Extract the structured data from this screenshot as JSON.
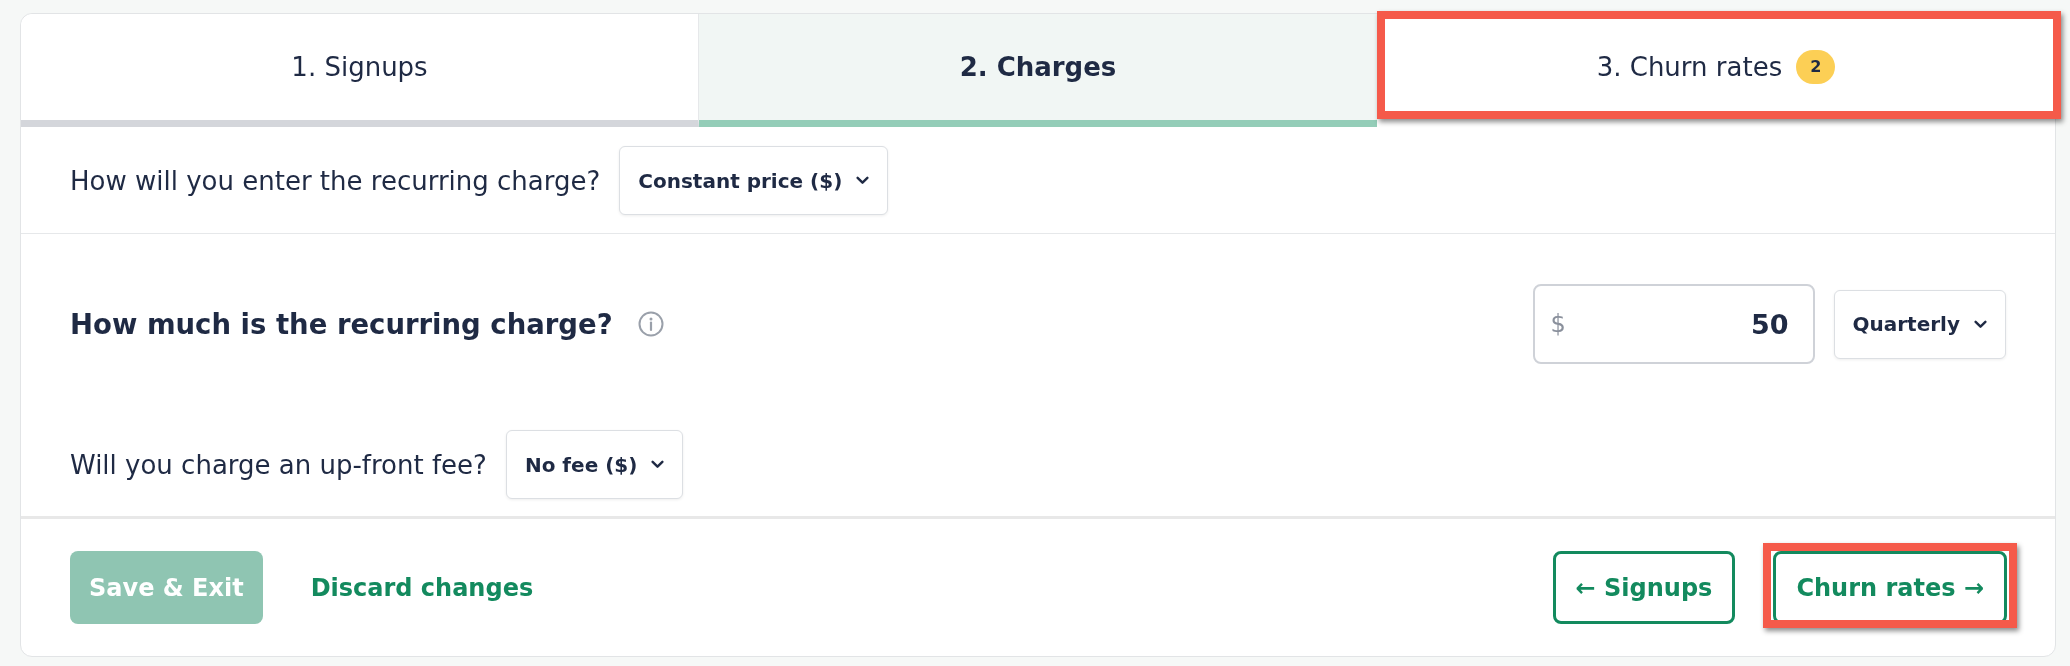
{
  "tabs": [
    {
      "label": "1. Signups",
      "selected": false,
      "visited": true,
      "highlighted": false
    },
    {
      "label": "2. Charges",
      "selected": true,
      "visited": true,
      "highlighted": false
    },
    {
      "label": "3. Churn rates",
      "selected": false,
      "visited": false,
      "highlighted": true,
      "badge": "2"
    }
  ],
  "sections": [
    {
      "questions": [
        {
          "kind": "select",
          "label": "How will you enter the recurring charge?",
          "value": "Constant price ($)"
        }
      ]
    },
    {
      "questions": [
        {
          "kind": "amount",
          "label": "How much is the recurring charge?",
          "info": true,
          "currency": "$",
          "amount": "50",
          "period": "Quarterly"
        },
        {
          "kind": "select",
          "label": "Will you charge an up-front fee?",
          "value": "No fee ($)"
        }
      ]
    }
  ],
  "footer": {
    "save_button": {
      "label": "Save & Exit",
      "disabled": true
    },
    "discard_link": "Discard changes",
    "back_button": {
      "label": "← Signups",
      "highlighted": false
    },
    "next_button": {
      "label": "Churn rates →",
      "highlighted": true
    }
  }
}
